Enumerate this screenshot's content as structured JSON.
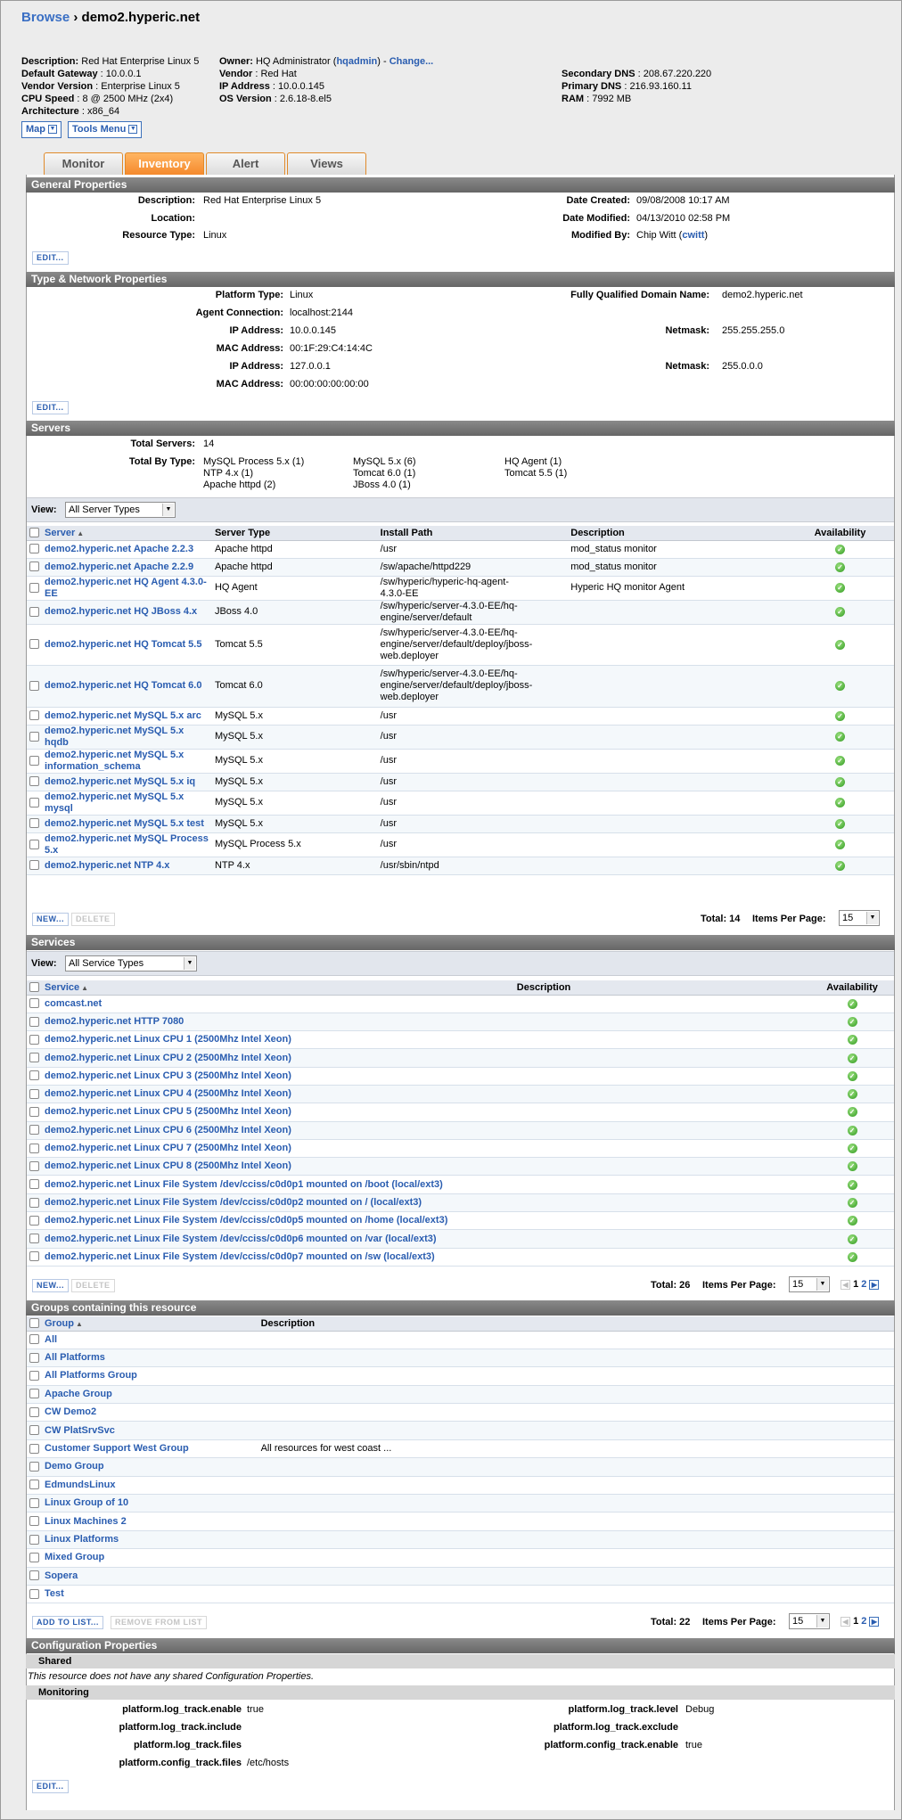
{
  "breadcrumb": {
    "browse": "Browse",
    "sep": "›",
    "current": "demo2.hyperic.net"
  },
  "summary": {
    "col1": [
      [
        "Description:",
        "Red Hat Enterprise Linux 5"
      ],
      [
        "Default Gateway",
        "10.0.0.1"
      ],
      [
        "Vendor Version",
        "Enterprise Linux 5"
      ],
      [
        "CPU Speed",
        "8 @ 2500 MHz (2x4)"
      ],
      [
        "Architecture",
        "x86_64"
      ]
    ],
    "owner_label": "Owner:",
    "owner": "HQ Administrator (",
    "owner_link": "hqadmin",
    "owner_end": ") - ",
    "change": "Change...",
    "col2": [
      [
        "Vendor",
        "Red Hat"
      ],
      [
        "IP Address",
        "10.0.0.145"
      ],
      [
        "OS Version",
        "2.6.18-8.el5"
      ]
    ],
    "col3": [
      [
        "Secondary DNS",
        "208.67.220.220"
      ],
      [
        "Primary DNS",
        "216.93.160.11"
      ],
      [
        "RAM",
        "7992 MB"
      ]
    ]
  },
  "tools": {
    "map": "Map",
    "tools_menu": "Tools Menu"
  },
  "tabs": [
    "Monitor",
    "Inventory",
    "Alert",
    "Views"
  ],
  "general": {
    "title": "General Properties",
    "description_label": "Description:",
    "description": "Red Hat Enterprise Linux 5",
    "location_label": "Location:",
    "location": "",
    "resource_type_label": "Resource Type:",
    "resource_type": "Linux",
    "date_created_label": "Date Created:",
    "date_created": "09/08/2008 10:17 AM",
    "date_modified_label": "Date Modified:",
    "date_modified": "04/13/2010 02:58 PM",
    "modified_by_label": "Modified By:",
    "modified_by": "Chip Witt (",
    "modified_by_link": "cwitt",
    "modified_by_end": ")",
    "edit": "EDIT..."
  },
  "network": {
    "title": "Type & Network Properties",
    "rows": [
      {
        "label": "Platform Type:",
        "value": "Linux"
      },
      {
        "label": "Agent Connection:",
        "value": "localhost:2144"
      },
      {
        "label": "IP Address:",
        "value": "10.0.0.145"
      },
      {
        "label": "MAC Address:",
        "value": "00:1F:29:C4:14:4C"
      },
      {
        "label": "IP Address:",
        "value": "127.0.0.1"
      },
      {
        "label": "MAC Address:",
        "value": "00:00:00:00:00:00"
      }
    ],
    "fqdn_label": "Fully Qualified Domain Name:",
    "fqdn": "demo2.hyperic.net",
    "netmask_label": "Netmask:",
    "netmask1": "255.255.255.0",
    "netmask2": "255.0.0.0",
    "edit": "EDIT..."
  },
  "servers": {
    "title": "Servers",
    "total_label": "Total Servers:",
    "total": "14",
    "by_type_label": "Total By Type:",
    "types": [
      [
        "MySQL Process 5.x (1)",
        "NTP 4.x (1)",
        "Apache httpd (2)"
      ],
      [
        "MySQL 5.x (6)",
        "Tomcat 6.0 (1)",
        "JBoss 4.0 (1)"
      ],
      [
        "HQ Agent (1)",
        "Tomcat 5.5 (1)"
      ]
    ],
    "view_label": "View:",
    "view_value": "All Server Types",
    "headers": [
      "Server",
      "Server Type",
      "Install Path",
      "Description",
      "Availability"
    ],
    "rows": [
      [
        "demo2.hyperic.net Apache 2.2.3",
        "Apache httpd",
        "/usr",
        "mod_status monitor"
      ],
      [
        "demo2.hyperic.net Apache 2.2.9",
        "Apache httpd",
        "/sw/apache/httpd229",
        "mod_status monitor"
      ],
      [
        "demo2.hyperic.net HQ Agent 4.3.0-EE",
        "HQ Agent",
        "/sw/hyperic/hyperic-hq-agent-4.3.0-EE",
        "Hyperic HQ monitor Agent"
      ],
      [
        "demo2.hyperic.net HQ JBoss 4.x",
        "JBoss 4.0",
        "/sw/hyperic/server-4.3.0-EE/hq-engine/server/default",
        ""
      ],
      [
        "demo2.hyperic.net HQ Tomcat 5.5",
        "Tomcat 5.5",
        "/sw/hyperic/server-4.3.0-EE/hq-engine/server/default/deploy/jboss-web.deployer",
        ""
      ],
      [
        "demo2.hyperic.net HQ Tomcat 6.0",
        "Tomcat 6.0",
        "/sw/hyperic/server-4.3.0-EE/hq-engine/server/default/deploy/jboss-web.deployer",
        ""
      ],
      [
        "demo2.hyperic.net MySQL 5.x arc",
        "MySQL 5.x",
        "/usr",
        ""
      ],
      [
        "demo2.hyperic.net MySQL 5.x hqdb",
        "MySQL 5.x",
        "/usr",
        ""
      ],
      [
        "demo2.hyperic.net MySQL 5.x information_schema",
        "MySQL 5.x",
        "/usr",
        ""
      ],
      [
        "demo2.hyperic.net MySQL 5.x iq",
        "MySQL 5.x",
        "/usr",
        ""
      ],
      [
        "demo2.hyperic.net MySQL 5.x mysql",
        "MySQL 5.x",
        "/usr",
        ""
      ],
      [
        "demo2.hyperic.net MySQL 5.x test",
        "MySQL 5.x",
        "/usr",
        ""
      ],
      [
        "demo2.hyperic.net MySQL Process 5.x",
        "MySQL Process 5.x",
        "/usr",
        ""
      ],
      [
        "demo2.hyperic.net NTP 4.x",
        "NTP 4.x",
        "/usr/sbin/ntpd",
        ""
      ]
    ],
    "new": "NEW...",
    "delete": "DELETE",
    "total_text": "Total: 14",
    "items_label": "Items Per Page:",
    "items": "15"
  },
  "services": {
    "title": "Services",
    "view_label": "View:",
    "view_value": "All Service Types",
    "headers": [
      "Service",
      "Description",
      "Availability"
    ],
    "rows": [
      "comcast.net",
      "demo2.hyperic.net HTTP 7080",
      "demo2.hyperic.net Linux CPU 1 (2500Mhz Intel Xeon)",
      "demo2.hyperic.net Linux CPU 2 (2500Mhz Intel Xeon)",
      "demo2.hyperic.net Linux CPU 3 (2500Mhz Intel Xeon)",
      "demo2.hyperic.net Linux CPU 4 (2500Mhz Intel Xeon)",
      "demo2.hyperic.net Linux CPU 5 (2500Mhz Intel Xeon)",
      "demo2.hyperic.net Linux CPU 6 (2500Mhz Intel Xeon)",
      "demo2.hyperic.net Linux CPU 7 (2500Mhz Intel Xeon)",
      "demo2.hyperic.net Linux CPU 8 (2500Mhz Intel Xeon)",
      "demo2.hyperic.net Linux File System /dev/cciss/c0d0p1 mounted on /boot (local/ext3)",
      "demo2.hyperic.net Linux File System /dev/cciss/c0d0p2 mounted on / (local/ext3)",
      "demo2.hyperic.net Linux File System /dev/cciss/c0d0p5 mounted on /home (local/ext3)",
      "demo2.hyperic.net Linux File System /dev/cciss/c0d0p6 mounted on /var (local/ext3)",
      "demo2.hyperic.net Linux File System /dev/cciss/c0d0p7 mounted on /sw (local/ext3)"
    ],
    "new": "NEW...",
    "delete": "DELETE",
    "total_text": "Total: 26",
    "items_label": "Items Per Page:",
    "items": "15",
    "page1": "1",
    "page2": "2"
  },
  "groups": {
    "title": "Groups containing this resource",
    "headers": [
      "Group",
      "Description"
    ],
    "rows": [
      [
        "All",
        ""
      ],
      [
        "All Platforms",
        ""
      ],
      [
        "All Platforms Group",
        ""
      ],
      [
        "Apache Group",
        ""
      ],
      [
        "CW Demo2",
        ""
      ],
      [
        "CW PlatSrvSvc",
        ""
      ],
      [
        "Customer Support West Group",
        "All resources for west coast ..."
      ],
      [
        "Demo Group",
        ""
      ],
      [
        "EdmundsLinux",
        ""
      ],
      [
        "Linux Group of 10",
        ""
      ],
      [
        "Linux Machines 2",
        ""
      ],
      [
        "Linux Platforms",
        ""
      ],
      [
        "Mixed Group",
        ""
      ],
      [
        "Sopera",
        ""
      ],
      [
        "Test",
        ""
      ]
    ],
    "add": "ADD TO LIST...",
    "remove": "REMOVE FROM LIST",
    "total_text": "Total: 22",
    "items_label": "Items Per Page:",
    "items": "15",
    "page1": "1",
    "page2": "2"
  },
  "config": {
    "title": "Configuration Properties",
    "shared": "Shared",
    "shared_note": "This resource does not have any shared Configuration Properties.",
    "monitoring": "Monitoring",
    "left": [
      [
        "platform.log_track.enable",
        "true"
      ],
      [
        "platform.log_track.include",
        ""
      ],
      [
        "platform.log_track.files",
        ""
      ],
      [
        "platform.config_track.files",
        "/etc/hosts"
      ]
    ],
    "right": [
      [
        "platform.log_track.level",
        "Debug"
      ],
      [
        "platform.log_track.exclude",
        ""
      ],
      [
        "platform.config_track.enable",
        "true"
      ]
    ],
    "edit": "EDIT..."
  }
}
